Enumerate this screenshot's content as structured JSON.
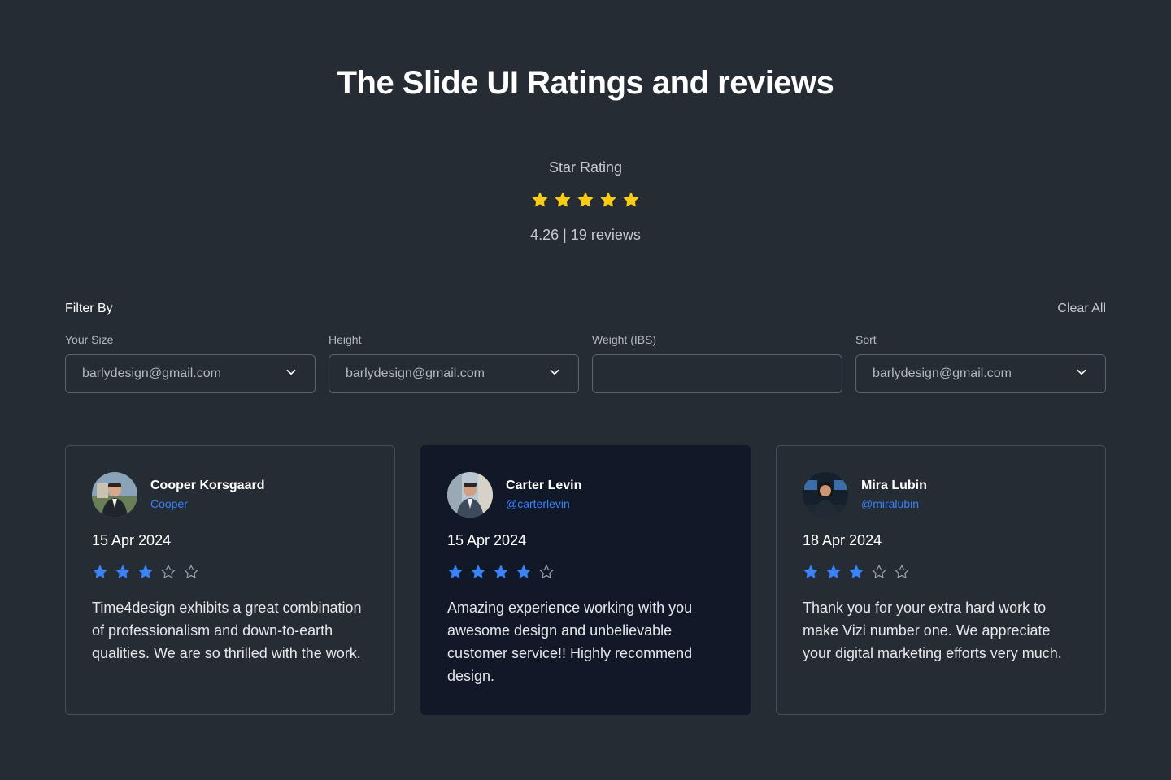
{
  "header": {
    "title": "The Slide UI Ratings and reviews",
    "rating_label": "Star Rating",
    "rating_stars": 5,
    "rating_summary": "4.26 | 19 reviews",
    "star_color": "#facc15"
  },
  "filters": {
    "title": "Filter By",
    "clear_all": "Clear All",
    "items": [
      {
        "label": "Your Size",
        "value": "barlydesign@gmail.com",
        "icon": "chevron-down-icon"
      },
      {
        "label": "Height",
        "value": "barlydesign@gmail.com",
        "icon": "chevron-down-icon"
      },
      {
        "label": "Weight (IBS)",
        "value": ""
      },
      {
        "label": "Sort",
        "value": "barlydesign@gmail.com",
        "icon": "chevron-down-icon"
      }
    ]
  },
  "reviews": [
    {
      "name": "Cooper Korsgaard",
      "handle": "Cooper",
      "date": "15 Apr 2024",
      "rating": 3,
      "text": "Time4design exhibits a great combination of professionalism and down-to-earth qualities. We are so thrilled with the work."
    },
    {
      "name": "Carter Levin",
      "handle": "@carterlevin",
      "date": "15 Apr 2024",
      "rating": 4,
      "text": "Amazing experience working with you awesome design and unbelievable customer service!! Highly recommend design."
    },
    {
      "name": "Mira Lubin",
      "handle": "@miralubin",
      "date": "18 Apr 2024",
      "rating": 3,
      "text": "Thank you for your extra hard work to make Vizi number one. We appreciate your digital marketing efforts very much."
    }
  ],
  "colors": {
    "background": "#262c33",
    "highlight_card": "#111827",
    "review_star": "#3b82f6",
    "handle": "#3b82f6"
  }
}
